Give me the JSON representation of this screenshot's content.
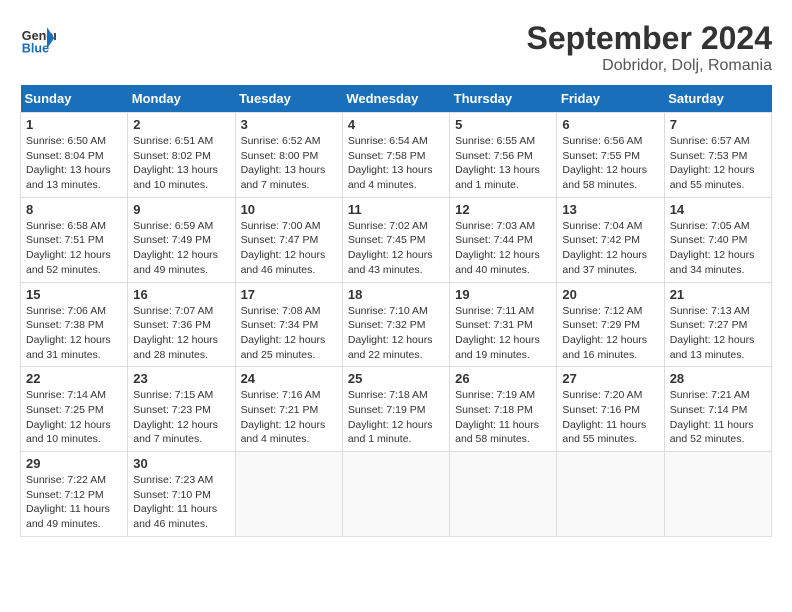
{
  "logo": {
    "line1": "General",
    "line2": "Blue"
  },
  "title": "September 2024",
  "subtitle": "Dobridor, Dolj, Romania",
  "weekdays": [
    "Sunday",
    "Monday",
    "Tuesday",
    "Wednesday",
    "Thursday",
    "Friday",
    "Saturday"
  ],
  "weeks": [
    [
      {
        "day": "1",
        "info": "Sunrise: 6:50 AM\nSunset: 8:04 PM\nDaylight: 13 hours\nand 13 minutes."
      },
      {
        "day": "2",
        "info": "Sunrise: 6:51 AM\nSunset: 8:02 PM\nDaylight: 13 hours\nand 10 minutes."
      },
      {
        "day": "3",
        "info": "Sunrise: 6:52 AM\nSunset: 8:00 PM\nDaylight: 13 hours\nand 7 minutes."
      },
      {
        "day": "4",
        "info": "Sunrise: 6:54 AM\nSunset: 7:58 PM\nDaylight: 13 hours\nand 4 minutes."
      },
      {
        "day": "5",
        "info": "Sunrise: 6:55 AM\nSunset: 7:56 PM\nDaylight: 13 hours\nand 1 minute."
      },
      {
        "day": "6",
        "info": "Sunrise: 6:56 AM\nSunset: 7:55 PM\nDaylight: 12 hours\nand 58 minutes."
      },
      {
        "day": "7",
        "info": "Sunrise: 6:57 AM\nSunset: 7:53 PM\nDaylight: 12 hours\nand 55 minutes."
      }
    ],
    [
      {
        "day": "8",
        "info": "Sunrise: 6:58 AM\nSunset: 7:51 PM\nDaylight: 12 hours\nand 52 minutes."
      },
      {
        "day": "9",
        "info": "Sunrise: 6:59 AM\nSunset: 7:49 PM\nDaylight: 12 hours\nand 49 minutes."
      },
      {
        "day": "10",
        "info": "Sunrise: 7:00 AM\nSunset: 7:47 PM\nDaylight: 12 hours\nand 46 minutes."
      },
      {
        "day": "11",
        "info": "Sunrise: 7:02 AM\nSunset: 7:45 PM\nDaylight: 12 hours\nand 43 minutes."
      },
      {
        "day": "12",
        "info": "Sunrise: 7:03 AM\nSunset: 7:44 PM\nDaylight: 12 hours\nand 40 minutes."
      },
      {
        "day": "13",
        "info": "Sunrise: 7:04 AM\nSunset: 7:42 PM\nDaylight: 12 hours\nand 37 minutes."
      },
      {
        "day": "14",
        "info": "Sunrise: 7:05 AM\nSunset: 7:40 PM\nDaylight: 12 hours\nand 34 minutes."
      }
    ],
    [
      {
        "day": "15",
        "info": "Sunrise: 7:06 AM\nSunset: 7:38 PM\nDaylight: 12 hours\nand 31 minutes."
      },
      {
        "day": "16",
        "info": "Sunrise: 7:07 AM\nSunset: 7:36 PM\nDaylight: 12 hours\nand 28 minutes."
      },
      {
        "day": "17",
        "info": "Sunrise: 7:08 AM\nSunset: 7:34 PM\nDaylight: 12 hours\nand 25 minutes."
      },
      {
        "day": "18",
        "info": "Sunrise: 7:10 AM\nSunset: 7:32 PM\nDaylight: 12 hours\nand 22 minutes."
      },
      {
        "day": "19",
        "info": "Sunrise: 7:11 AM\nSunset: 7:31 PM\nDaylight: 12 hours\nand 19 minutes."
      },
      {
        "day": "20",
        "info": "Sunrise: 7:12 AM\nSunset: 7:29 PM\nDaylight: 12 hours\nand 16 minutes."
      },
      {
        "day": "21",
        "info": "Sunrise: 7:13 AM\nSunset: 7:27 PM\nDaylight: 12 hours\nand 13 minutes."
      }
    ],
    [
      {
        "day": "22",
        "info": "Sunrise: 7:14 AM\nSunset: 7:25 PM\nDaylight: 12 hours\nand 10 minutes."
      },
      {
        "day": "23",
        "info": "Sunrise: 7:15 AM\nSunset: 7:23 PM\nDaylight: 12 hours\nand 7 minutes."
      },
      {
        "day": "24",
        "info": "Sunrise: 7:16 AM\nSunset: 7:21 PM\nDaylight: 12 hours\nand 4 minutes."
      },
      {
        "day": "25",
        "info": "Sunrise: 7:18 AM\nSunset: 7:19 PM\nDaylight: 12 hours\nand 1 minute."
      },
      {
        "day": "26",
        "info": "Sunrise: 7:19 AM\nSunset: 7:18 PM\nDaylight: 11 hours\nand 58 minutes."
      },
      {
        "day": "27",
        "info": "Sunrise: 7:20 AM\nSunset: 7:16 PM\nDaylight: 11 hours\nand 55 minutes."
      },
      {
        "day": "28",
        "info": "Sunrise: 7:21 AM\nSunset: 7:14 PM\nDaylight: 11 hours\nand 52 minutes."
      }
    ],
    [
      {
        "day": "29",
        "info": "Sunrise: 7:22 AM\nSunset: 7:12 PM\nDaylight: 11 hours\nand 49 minutes."
      },
      {
        "day": "30",
        "info": "Sunrise: 7:23 AM\nSunset: 7:10 PM\nDaylight: 11 hours\nand 46 minutes."
      },
      {
        "day": "",
        "info": ""
      },
      {
        "day": "",
        "info": ""
      },
      {
        "day": "",
        "info": ""
      },
      {
        "day": "",
        "info": ""
      },
      {
        "day": "",
        "info": ""
      }
    ]
  ]
}
